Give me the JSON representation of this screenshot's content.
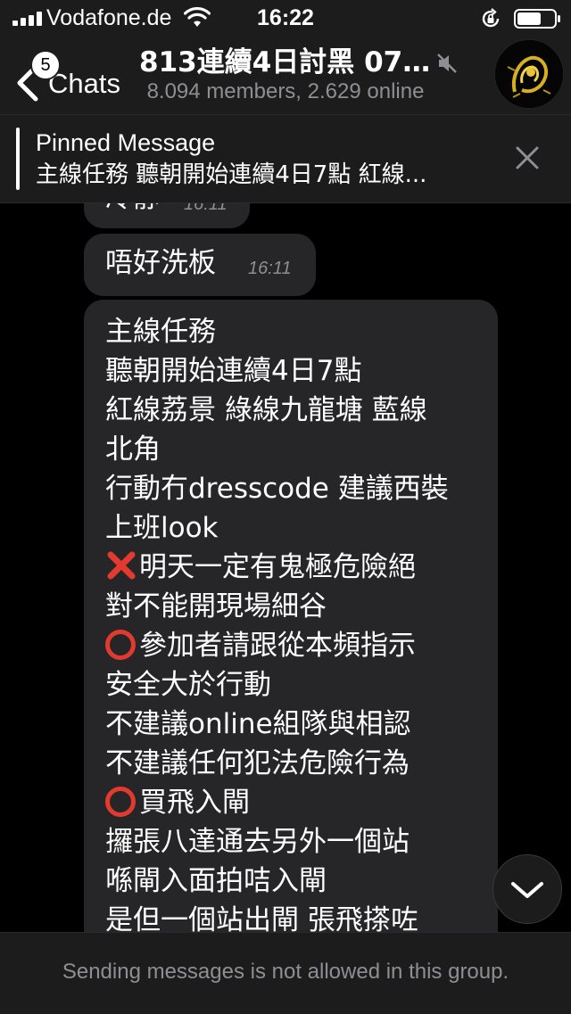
{
  "status_bar": {
    "carrier": "Vodafone.de",
    "time": "16:22"
  },
  "nav": {
    "back_label": "Chats",
    "unread_count": "5",
    "title": "813連續4日討黑 07...",
    "subtitle": "8.094 members, 2.629 online"
  },
  "pinned": {
    "title": "Pinned Message",
    "text": "主線任務 聽朝開始連續4日7點 紅線..."
  },
  "messages": [
    {
      "text": "冷靜",
      "time": "16:11"
    },
    {
      "text": "唔好洗板",
      "time": "16:11"
    },
    {
      "lines": [
        "主線任務",
        "聽朝開始連續4日7點",
        "紅線荔景 綠線九龍塘 藍線",
        "北角",
        "行動冇dresscode 建議西裝",
        "上班look",
        "明天一定有鬼極危險絕",
        "對不能開現場細谷",
        "參加者請跟從本頻指示",
        "安全大於行動",
        "不建議online組隊與相認",
        "不建議任何犯法危險行為",
        "買飛入閘",
        "攞張八達通去另外一個站",
        "喺閘入面拍咭入閘",
        "是但一個站出閘 張飛搽咗"
      ],
      "emoji_lines": {
        "6": "cross-mark",
        "8": "hollow-red-circle",
        "12": "hollow-red-circle"
      }
    }
  ],
  "footer": {
    "notice": "Sending messages is not allowed in this group."
  },
  "colors": {
    "background": "#000000",
    "bar": "#1c1c1d",
    "bubble": "#262628",
    "secondary_text": "#8e8e93",
    "emoji_red": "#e23a2e"
  }
}
